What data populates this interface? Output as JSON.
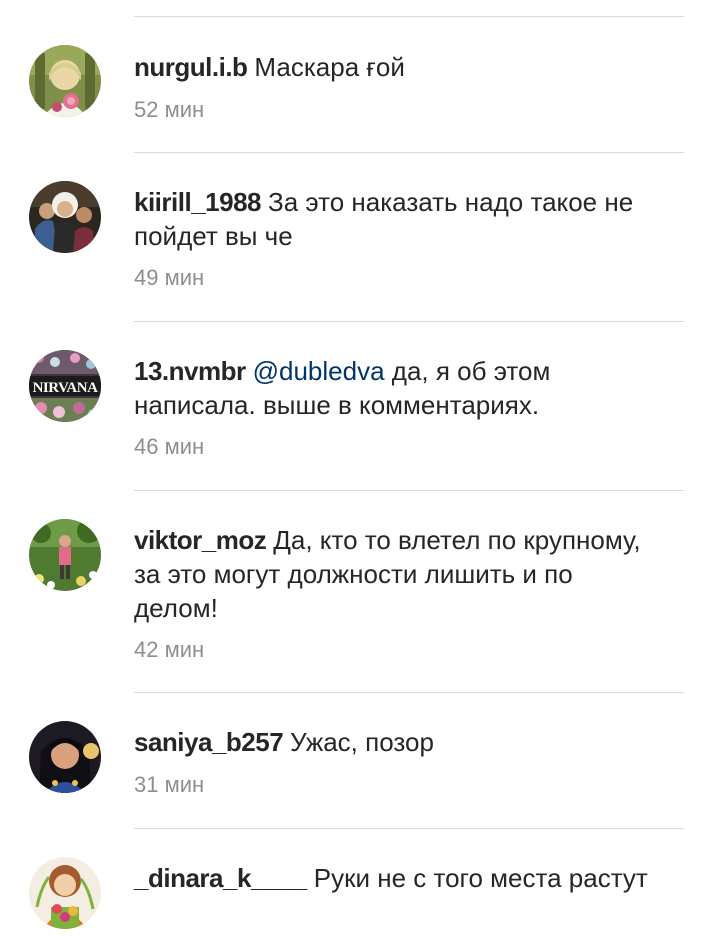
{
  "comments": [
    {
      "username": "nurgul.i.b",
      "text": "Маскара ғой",
      "time": "52 мин",
      "avatar_icon": "user-photo-avatar"
    },
    {
      "username": "kiirill_1988",
      "text": "За это наказать надо такое не пойдет вы че",
      "time": "49 мин",
      "avatar_icon": "user-photo-avatar"
    },
    {
      "username": "13.nvmbr",
      "mention": "@dubledva",
      "text": "да, я об этом написала.  выше в комментариях.",
      "time": "46 мин",
      "avatar_icon": "nirvana-logo-avatar",
      "avatar_text": "NIRVANA"
    },
    {
      "username": "viktor_moz",
      "text": "Да, кто то влетел по крупному, за это могут должности лишить и по делом!",
      "time": "42 мин",
      "avatar_icon": "user-photo-avatar"
    },
    {
      "username": "saniya_b257",
      "text": "Ужас, позор",
      "time": "31 мин",
      "avatar_icon": "user-photo-avatar"
    },
    {
      "username": "_dinara_k____",
      "text": "Руки не с того места растут",
      "time": "",
      "avatar_icon": "cartoon-avatar"
    }
  ],
  "colors": {
    "text": "#262626",
    "secondary": "#8e8e8e",
    "mention": "#003569",
    "divider": "#dbdbdb"
  }
}
